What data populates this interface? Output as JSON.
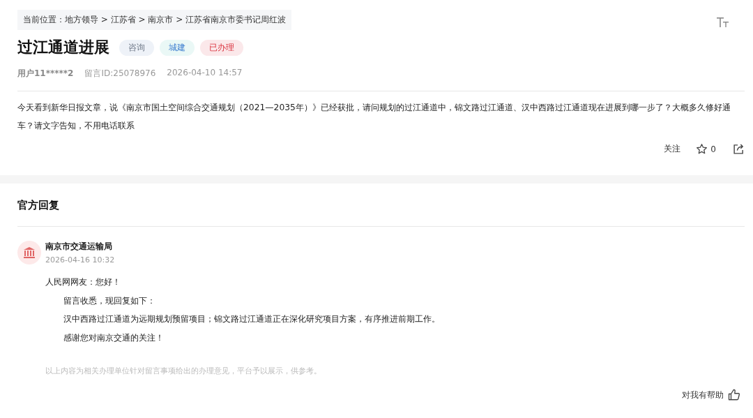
{
  "breadcrumb": "当前位置：地方领导 > 江苏省 > 南京市 > 江苏省南京市委书记周红波",
  "title": "过江通道进展",
  "tags": [
    {
      "label": "咨询",
      "color": "#eef2f8"
    },
    {
      "label": "城建",
      "color": "#eaf8f6"
    },
    {
      "label": "已办理",
      "color": "#fbe8ea"
    }
  ],
  "meta": {
    "user": "用户11*****2",
    "message_id": "留言ID:25078976",
    "time": "2026-04-10 14:57"
  },
  "message": "今天看到新华日报文章，说《南京市国土空间综合交通规划（2021—2035年）》已经获批，请问规划的过江通道中，锦文路过江通道、汉中西路过江通道现在进展到哪一步了？大概多久修好通车？请文字告知，不用电话联系",
  "actions": {
    "follow": "关注",
    "likes": "0"
  },
  "reply_section": {
    "heading": "官方回复",
    "org": "南京市交通运输局",
    "time": "2026-04-16 10:32",
    "lines": [
      {
        "text": "人民网网友：您好！",
        "indented": false
      },
      {
        "text": "留言收悉，现回复如下：",
        "indented": true
      },
      {
        "text": "汉中西路过江通道为远期规划预留项目；锦文路过江通道正在深化研究项目方案，有序推进前期工作。",
        "indented": true
      },
      {
        "text": "感谢您对南京交通的关注！",
        "indented": true
      }
    ],
    "note": "以上内容为相关办理单位针对留言事项给出的办理意见，平台予以展示，供参考。",
    "helpful": "对我有帮助"
  }
}
